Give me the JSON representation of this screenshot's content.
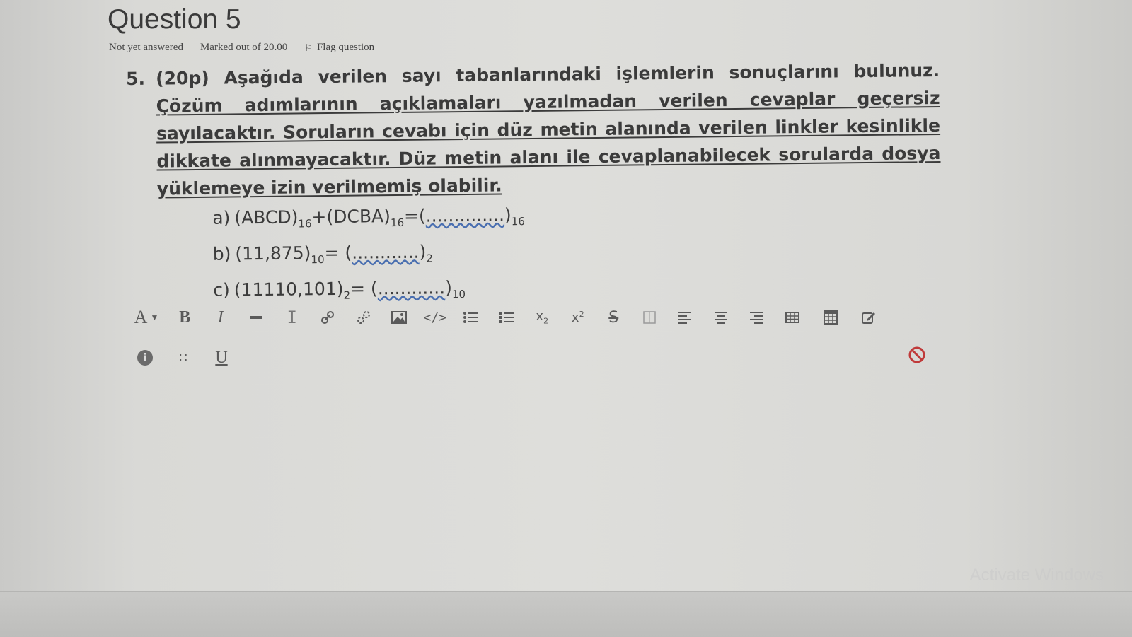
{
  "question": {
    "title": "Question 5",
    "status": "Not yet answered",
    "marks": "Marked out of 20.00",
    "flag_label": "Flag question",
    "number": "5.",
    "text_bold": "(20p) Aşağıda verilen sayı tabanlarındaki işlemlerin sonuçlarını bulunuz. ",
    "text_underlined": "Çözüm adımlarının açıklamaları yazılmadan verilen cevaplar geçersiz sayılacaktır. Soruların cevabı için düz metin alanında verilen linkler kesinlikle dikkate alınmayacaktır. Düz metin alanı ile cevaplanabilecek sorularda dosya yüklemeye izin verilmemiş olabilir.",
    "parts": [
      {
        "label": "a)",
        "expr": "(ABCD)",
        "sub1": "16",
        "op": "+(DCBA)",
        "sub2": "16",
        "eq": "=(",
        "blank": "..............",
        "close": ")",
        "sub3": "16"
      },
      {
        "label": "b)",
        "expr": "(11,875)",
        "sub1": "10",
        "eq": "= (",
        "blank": "............",
        "close": ")",
        "sub3": "2"
      },
      {
        "label": "c)",
        "expr": "(11110,101)",
        "sub1": "2",
        "eq": "= (",
        "blank": "............",
        "close": ")",
        "sub3": "10"
      }
    ]
  },
  "toolbar": {
    "font_btn": "A",
    "bold_btn": "B",
    "italic_btn": "I",
    "cursor_btn": "I",
    "underline_btn": "U",
    "info_btn": "i",
    "dots_btn": "∷"
  },
  "watermark": "Activate Windows"
}
